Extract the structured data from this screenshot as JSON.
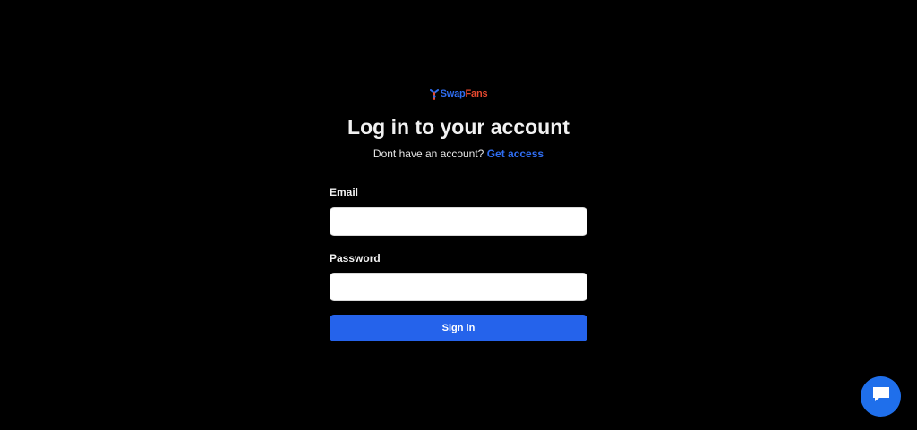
{
  "brand": {
    "part1": "Swap",
    "part2": "Fans",
    "swap_color": "#2f6df0",
    "fans_color": "#e8492f",
    "icon": "swapfans-logo-icon"
  },
  "login": {
    "title": "Log in to your account",
    "no_account_text": "Dont have an account?",
    "get_access_link": "Get access",
    "email_label": "Email",
    "email_value": "",
    "password_label": "Password",
    "password_value": "",
    "signin_label": "Sign in",
    "accent_color": "#2563eb"
  },
  "chat": {
    "icon": "chat-bubble-icon",
    "color": "#1f6feb"
  },
  "theme": {
    "background": "#000000"
  }
}
